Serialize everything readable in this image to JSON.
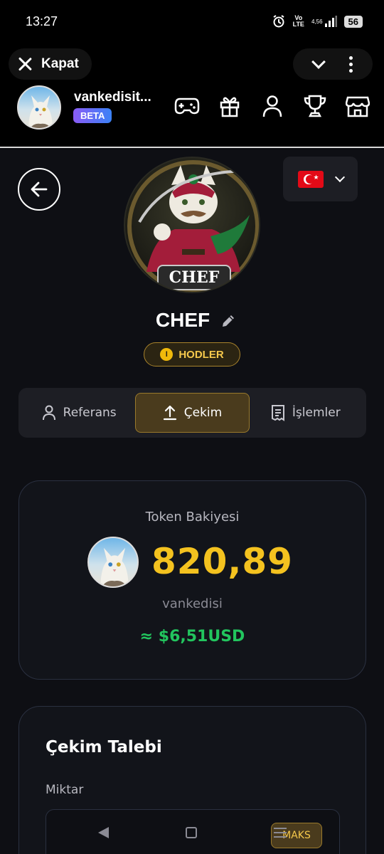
{
  "status": {
    "time": "13:27",
    "battery": "56",
    "network": "4,56"
  },
  "header": {
    "close_label": "Kapat",
    "username": "vankedisit...",
    "beta_label": "BETA",
    "nav_icons": [
      "gamepad-icon",
      "gift-icon",
      "user-icon",
      "trophy-icon",
      "shop-icon"
    ]
  },
  "profile": {
    "name": "CHEF",
    "image_caption": "CHEF",
    "badge": "HODLER",
    "coin_glyph": "I",
    "language_flag": "turkey-flag"
  },
  "tabs": [
    {
      "label": "Referans",
      "icon": "user-icon",
      "active": false
    },
    {
      "label": "Çekim",
      "icon": "upload-icon",
      "active": true
    },
    {
      "label": "İşlemler",
      "icon": "receipt-icon",
      "active": false
    }
  ],
  "balance": {
    "title": "Token Bakiyesi",
    "amount": "820,89",
    "unit": "vankedisi",
    "usd": "≈ $6,51USD"
  },
  "withdraw": {
    "title": "Çekim Talebi",
    "amount_label": "Miktar",
    "max_label": "MAKS"
  },
  "colors": {
    "accent": "#f4c21f",
    "usd_green": "#22c55e",
    "background": "#0e0f14",
    "beta_start": "#8a5cf6",
    "beta_end": "#3b82f6"
  }
}
